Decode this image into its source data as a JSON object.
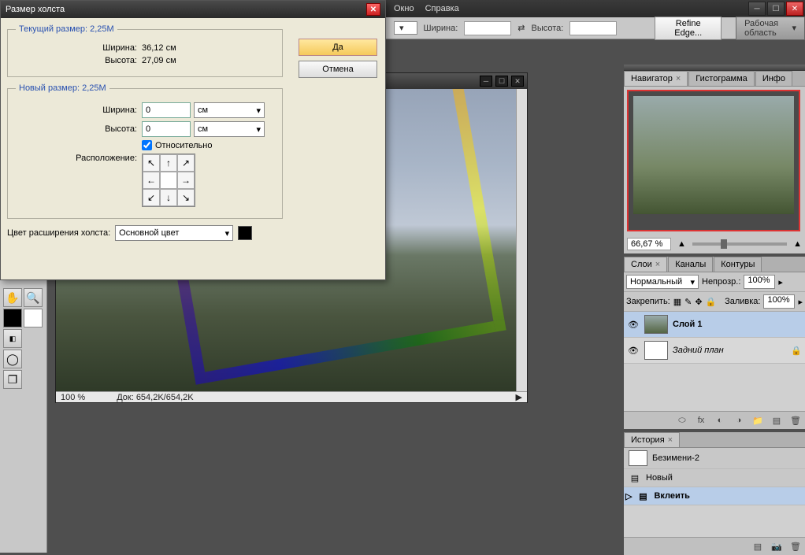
{
  "menubar": {
    "window": "Окно",
    "help": "Справка"
  },
  "options_bar": {
    "width_label": "Ширина:",
    "height_label": "Высота:",
    "refine": "Refine Edge...",
    "workspace": "Рабочая область"
  },
  "doc": {
    "zoom": "100 %",
    "status": "Док: 654,2K/654,2K"
  },
  "dialog": {
    "title": "Размер холста",
    "current_legend": "Текущий размер: 2,25M",
    "cur_width_label": "Ширина:",
    "cur_width_value": "36,12 см",
    "cur_height_label": "Высота:",
    "cur_height_value": "27,09 см",
    "new_legend": "Новый размер: 2,25M",
    "new_width_label": "Ширина:",
    "new_width_value": "0",
    "new_height_label": "Высота:",
    "new_height_value": "0",
    "unit": "см",
    "relative": "Относительно",
    "anchor_label": "Расположение:",
    "ext_label": "Цвет расширения холста:",
    "ext_value": "Основной цвет",
    "ok": "Да",
    "cancel": "Отмена"
  },
  "panels": {
    "navigator": {
      "tab": "Навигатор",
      "tab2": "Гистограмма",
      "tab3": "Инфо",
      "zoom": "66,67 %"
    },
    "layers": {
      "tab1": "Слои",
      "tab2": "Каналы",
      "tab3": "Контуры",
      "mode": "Нормальный",
      "opacity_label": "Непрозр.:",
      "opacity": "100%",
      "lock_label": "Закрепить:",
      "fill_label": "Заливка:",
      "fill": "100%",
      "layer1": "Слой 1",
      "bg": "Задний план"
    },
    "history": {
      "tab": "История",
      "doc_name": "Безимени-2",
      "step1": "Новый",
      "step2": "Вклеить"
    }
  }
}
